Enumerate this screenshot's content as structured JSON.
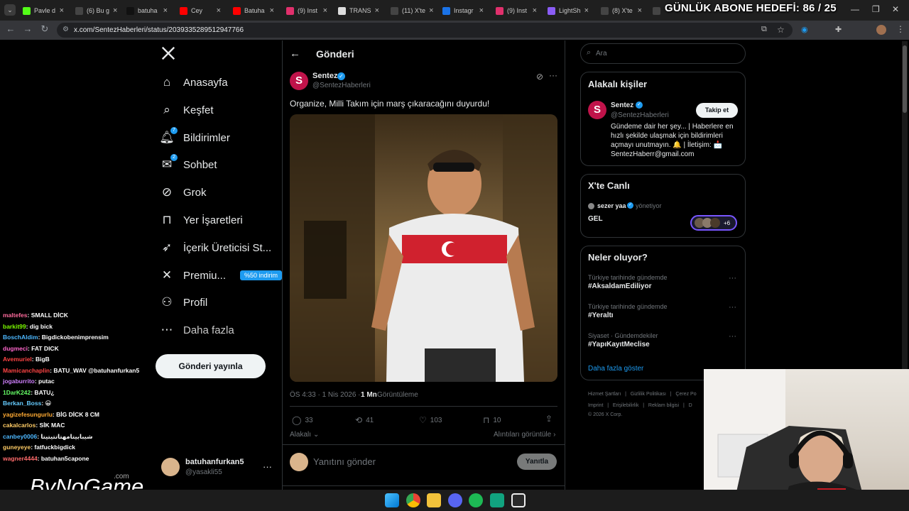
{
  "browser": {
    "tabs": [
      {
        "title": "Pavle d",
        "color": "#53fc18"
      },
      {
        "title": "(6) Bu g",
        "color": "#444"
      },
      {
        "title": "batuha",
        "color": "#111"
      },
      {
        "title": "Cey",
        "color": "#ff0000"
      },
      {
        "title": "Batuha",
        "color": "#ff0000"
      },
      {
        "title": "(9) Inst",
        "color": "#e1306c"
      },
      {
        "title": "TRANS",
        "color": "#dddddd"
      },
      {
        "title": "(11) X'te",
        "color": "#444"
      },
      {
        "title": "Instagr",
        "color": "#1a73e8"
      },
      {
        "title": "(9) Inst",
        "color": "#e1306c"
      },
      {
        "title": "LightSh",
        "color": "#8a5cf6"
      },
      {
        "title": "(8) X'te",
        "color": "#444"
      },
      {
        "title": "X",
        "color": "#444"
      }
    ],
    "overlay_goal": "GÜNLÜK ABONE HEDEFİ: 86 / 25",
    "url": "x.com/SentezHaberleri/status/2039335289512947766"
  },
  "nav": {
    "items": [
      {
        "label": "Anasayfa",
        "icon": "home-icon"
      },
      {
        "label": "Keşfet",
        "icon": "search-icon"
      },
      {
        "label": "Bildirimler",
        "icon": "bell-icon",
        "badge": "7"
      },
      {
        "label": "Sohbet",
        "icon": "chat-icon",
        "badge": "2"
      },
      {
        "label": "Grok",
        "icon": "grok-icon"
      },
      {
        "label": "Yer İşaretleri",
        "icon": "bookmark-icon"
      },
      {
        "label": "İçerik Üreticisi St...",
        "icon": "rocket-icon"
      },
      {
        "label": "Premiu...",
        "icon": "x-logo-icon"
      },
      {
        "label": "Profil",
        "icon": "person-icon"
      },
      {
        "label": "Daha fazla",
        "icon": "more-circle-icon"
      }
    ],
    "premium_badge": "%50 indirim",
    "post_button": "Gönderi yayınla",
    "account": {
      "name": "batuhanfurkan5",
      "handle": "@yasakli55"
    }
  },
  "post": {
    "header_title": "Gönderi",
    "author_name": "Sentez",
    "author_handle": "@SentezHaberleri",
    "text": "Organize, Milli Takım için marş çıkaracağını duyurdu!",
    "timestamp": "ÖS 4:33 · 1 Nis 2026 ·",
    "views_count": "1 Mn",
    "views_label": "Görüntüleme",
    "replies": "33",
    "reposts": "41",
    "likes": "103",
    "bookmarks": "10",
    "relevance": "Alakalı",
    "quotes": "Alıntıları görüntüle",
    "reply_placeholder": "Yanıtını gönder",
    "reply_button": "Yanıtla"
  },
  "sidebar": {
    "search_placeholder": "Ara",
    "related_title": "Alakalı kişiler",
    "related_name": "Sentez",
    "related_handle": "@SentezHaberleri",
    "follow_button": "Takip et",
    "bio_lines": [
      "Gündeme dair her şey... | Haberlere en",
      "hızlı şekilde ulaşmak için bildirimleri",
      "açmayı unutmayın. 🔔 | İletişim: 📩",
      "SentezHaberr@gmail.com"
    ],
    "live_title": "X'te Canlı",
    "live_host": "sezer yaa",
    "live_status": "yönetiyor",
    "live_name": "GEL",
    "live_extra": "+6",
    "trends_title": "Neler oluyor?",
    "trends": [
      {
        "context": "Türkiye tarihinde gündemde",
        "tag": "#AksaldamEdiliyor"
      },
      {
        "context": "Türkiye tarihinde gündemde",
        "tag": "#Yeraltı"
      },
      {
        "context": "Siyaset · Gündemdekiler",
        "tag": "#YapıKayıtMeclise"
      }
    ],
    "show_more": "Daha fazla göster",
    "footer_line1": "Hizmet Şartları   |   Gizlilik Politikası   |   Çerez Po",
    "footer_line2": "Imprint   |   Erişilebilirlik   |   Reklam bilgisi   |   D",
    "footer_line3": "© 2026 X Corp."
  },
  "chat": [
    {
      "user": "maltefes",
      "msg": ": SMALL DİCK",
      "color": "#ff6b9d"
    },
    {
      "user": "barkit99",
      "msg": ": dig bick",
      "color": "#7cfc00"
    },
    {
      "user": "BoschAldim",
      "msg": ": Bigdickobenimprensim",
      "color": "#4db8ff"
    },
    {
      "user": "dugmeci",
      "msg": ": FAT DICK",
      "color": "#ff66cc"
    },
    {
      "user": "Avemuriel",
      "msg": ": BigB",
      "color": "#ff4444"
    },
    {
      "user": "Mamicanchaplin",
      "msg": ": BATU_WAV @batuhanfurkan5",
      "color": "#ff4444"
    },
    {
      "user": "jogaburrito",
      "msg": ": putac",
      "color": "#d080ff"
    },
    {
      "user": "1DarK242",
      "msg": ": BATU¿",
      "color": "#66ff66"
    },
    {
      "user": "Berkan_Boss",
      "msg": ": 😀",
      "color": "#66ccff"
    },
    {
      "user": "yagizefesungurlu",
      "msg": ": BİG DİCK 8 CM",
      "color": "#ffaa33"
    },
    {
      "user": "cakalcarlos",
      "msg": ": SİK MAC",
      "color": "#ffcc66"
    },
    {
      "user": "canbey0006",
      "msg": ": شيبابيتامهتاتتيتيتا",
      "color": "#4db8ff"
    },
    {
      "user": "guneyeye",
      "msg": ": fatfuckbigdick",
      "color": "#ffcc66"
    },
    {
      "user": "wagner4444",
      "msg": ": batuhan5capone",
      "color": "#ff6b6b"
    }
  ],
  "watermark": "ByNoGame",
  "watermark_suffix": ".com"
}
